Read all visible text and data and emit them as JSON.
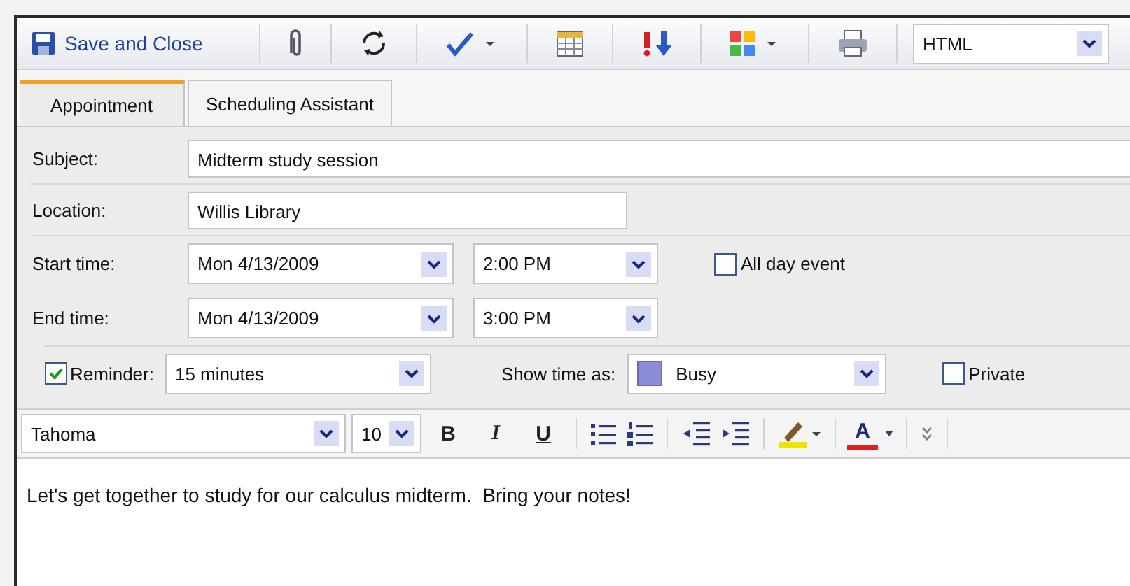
{
  "toolbar": {
    "save_label": "Save and Close",
    "format_value": "HTML"
  },
  "tabs": [
    {
      "label": "Appointment",
      "selected": true
    },
    {
      "label": "Scheduling Assistant",
      "selected": false
    }
  ],
  "subject": {
    "label": "Subject:",
    "value": "Midterm study session"
  },
  "location": {
    "label": "Location:",
    "value": "Willis Library"
  },
  "start": {
    "label": "Start time:",
    "date": "Mon 4/13/2009",
    "time": "2:00 PM"
  },
  "end": {
    "label": "End time:",
    "date": "Mon 4/13/2009",
    "time": "3:00 PM"
  },
  "all_day": {
    "label": "All day event",
    "checked": false
  },
  "reminder": {
    "label": "Reminder:",
    "checked": true,
    "value": "15 minutes"
  },
  "show_time_as": {
    "label": "Show time as:",
    "value": "Busy"
  },
  "private": {
    "label": "Private",
    "checked": false
  },
  "format_bar": {
    "font": "Tahoma",
    "size": "10",
    "bold": "B",
    "italic": "I",
    "underline": "U",
    "font_color": "A"
  },
  "body": "Let's get together to study for our calculus midterm.  Bring your notes!"
}
